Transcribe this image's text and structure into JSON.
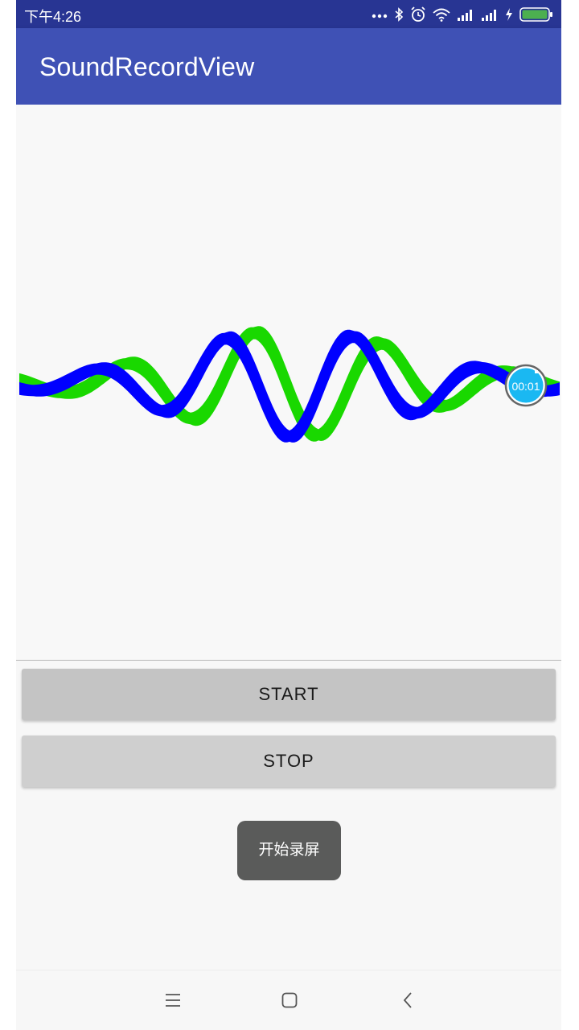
{
  "status_bar": {
    "time": "下午4:26",
    "icons": [
      "more-dots-icon",
      "bluetooth-icon",
      "alarm-icon",
      "wifi-icon",
      "signal-icon",
      "signal-icon",
      "charging-icon",
      "battery-icon"
    ],
    "battery_color": "#4caf50"
  },
  "app_bar": {
    "title": "SoundRecordView",
    "color": "#3f51b5",
    "status_color": "#283593"
  },
  "record_view": {
    "timer": "00:01",
    "wave_colors": [
      "#0000ff",
      "#19d800"
    ],
    "timer_color": "#1ab8f2"
  },
  "buttons": {
    "start_label": "START",
    "stop_label": "STOP"
  },
  "toast": {
    "text": "开始录屏"
  },
  "nav_bar": {
    "icons": [
      "menu-icon",
      "home-icon",
      "back-icon"
    ]
  }
}
